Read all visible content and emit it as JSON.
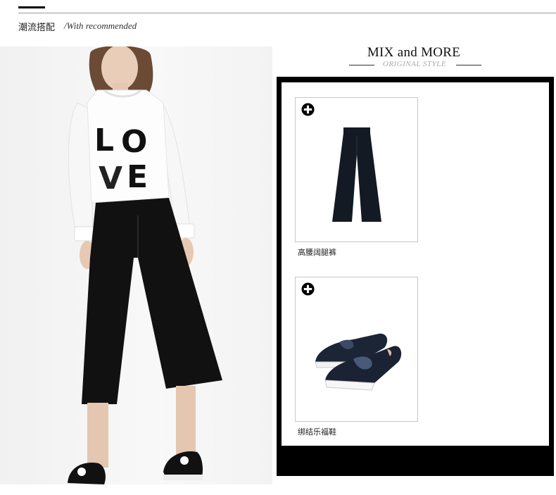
{
  "header": {
    "title_cn": "潮流搭配",
    "title_en": "/With recommended"
  },
  "model_photo": {
    "shirt_print": [
      "L",
      "O",
      "V",
      "E"
    ]
  },
  "mix": {
    "title": "MIX and MORE",
    "subtitle": "ORIGINAL STYLE"
  },
  "products": [
    {
      "name": "高腰阔腿裤",
      "icon": "plus-circle-icon"
    },
    {
      "name": "绑结乐福鞋",
      "icon": "plus-circle-icon"
    }
  ],
  "colors": {
    "frame": "#000000",
    "page_bg": "#ffffff",
    "subtitle_gray": "#aaaaaa"
  }
}
